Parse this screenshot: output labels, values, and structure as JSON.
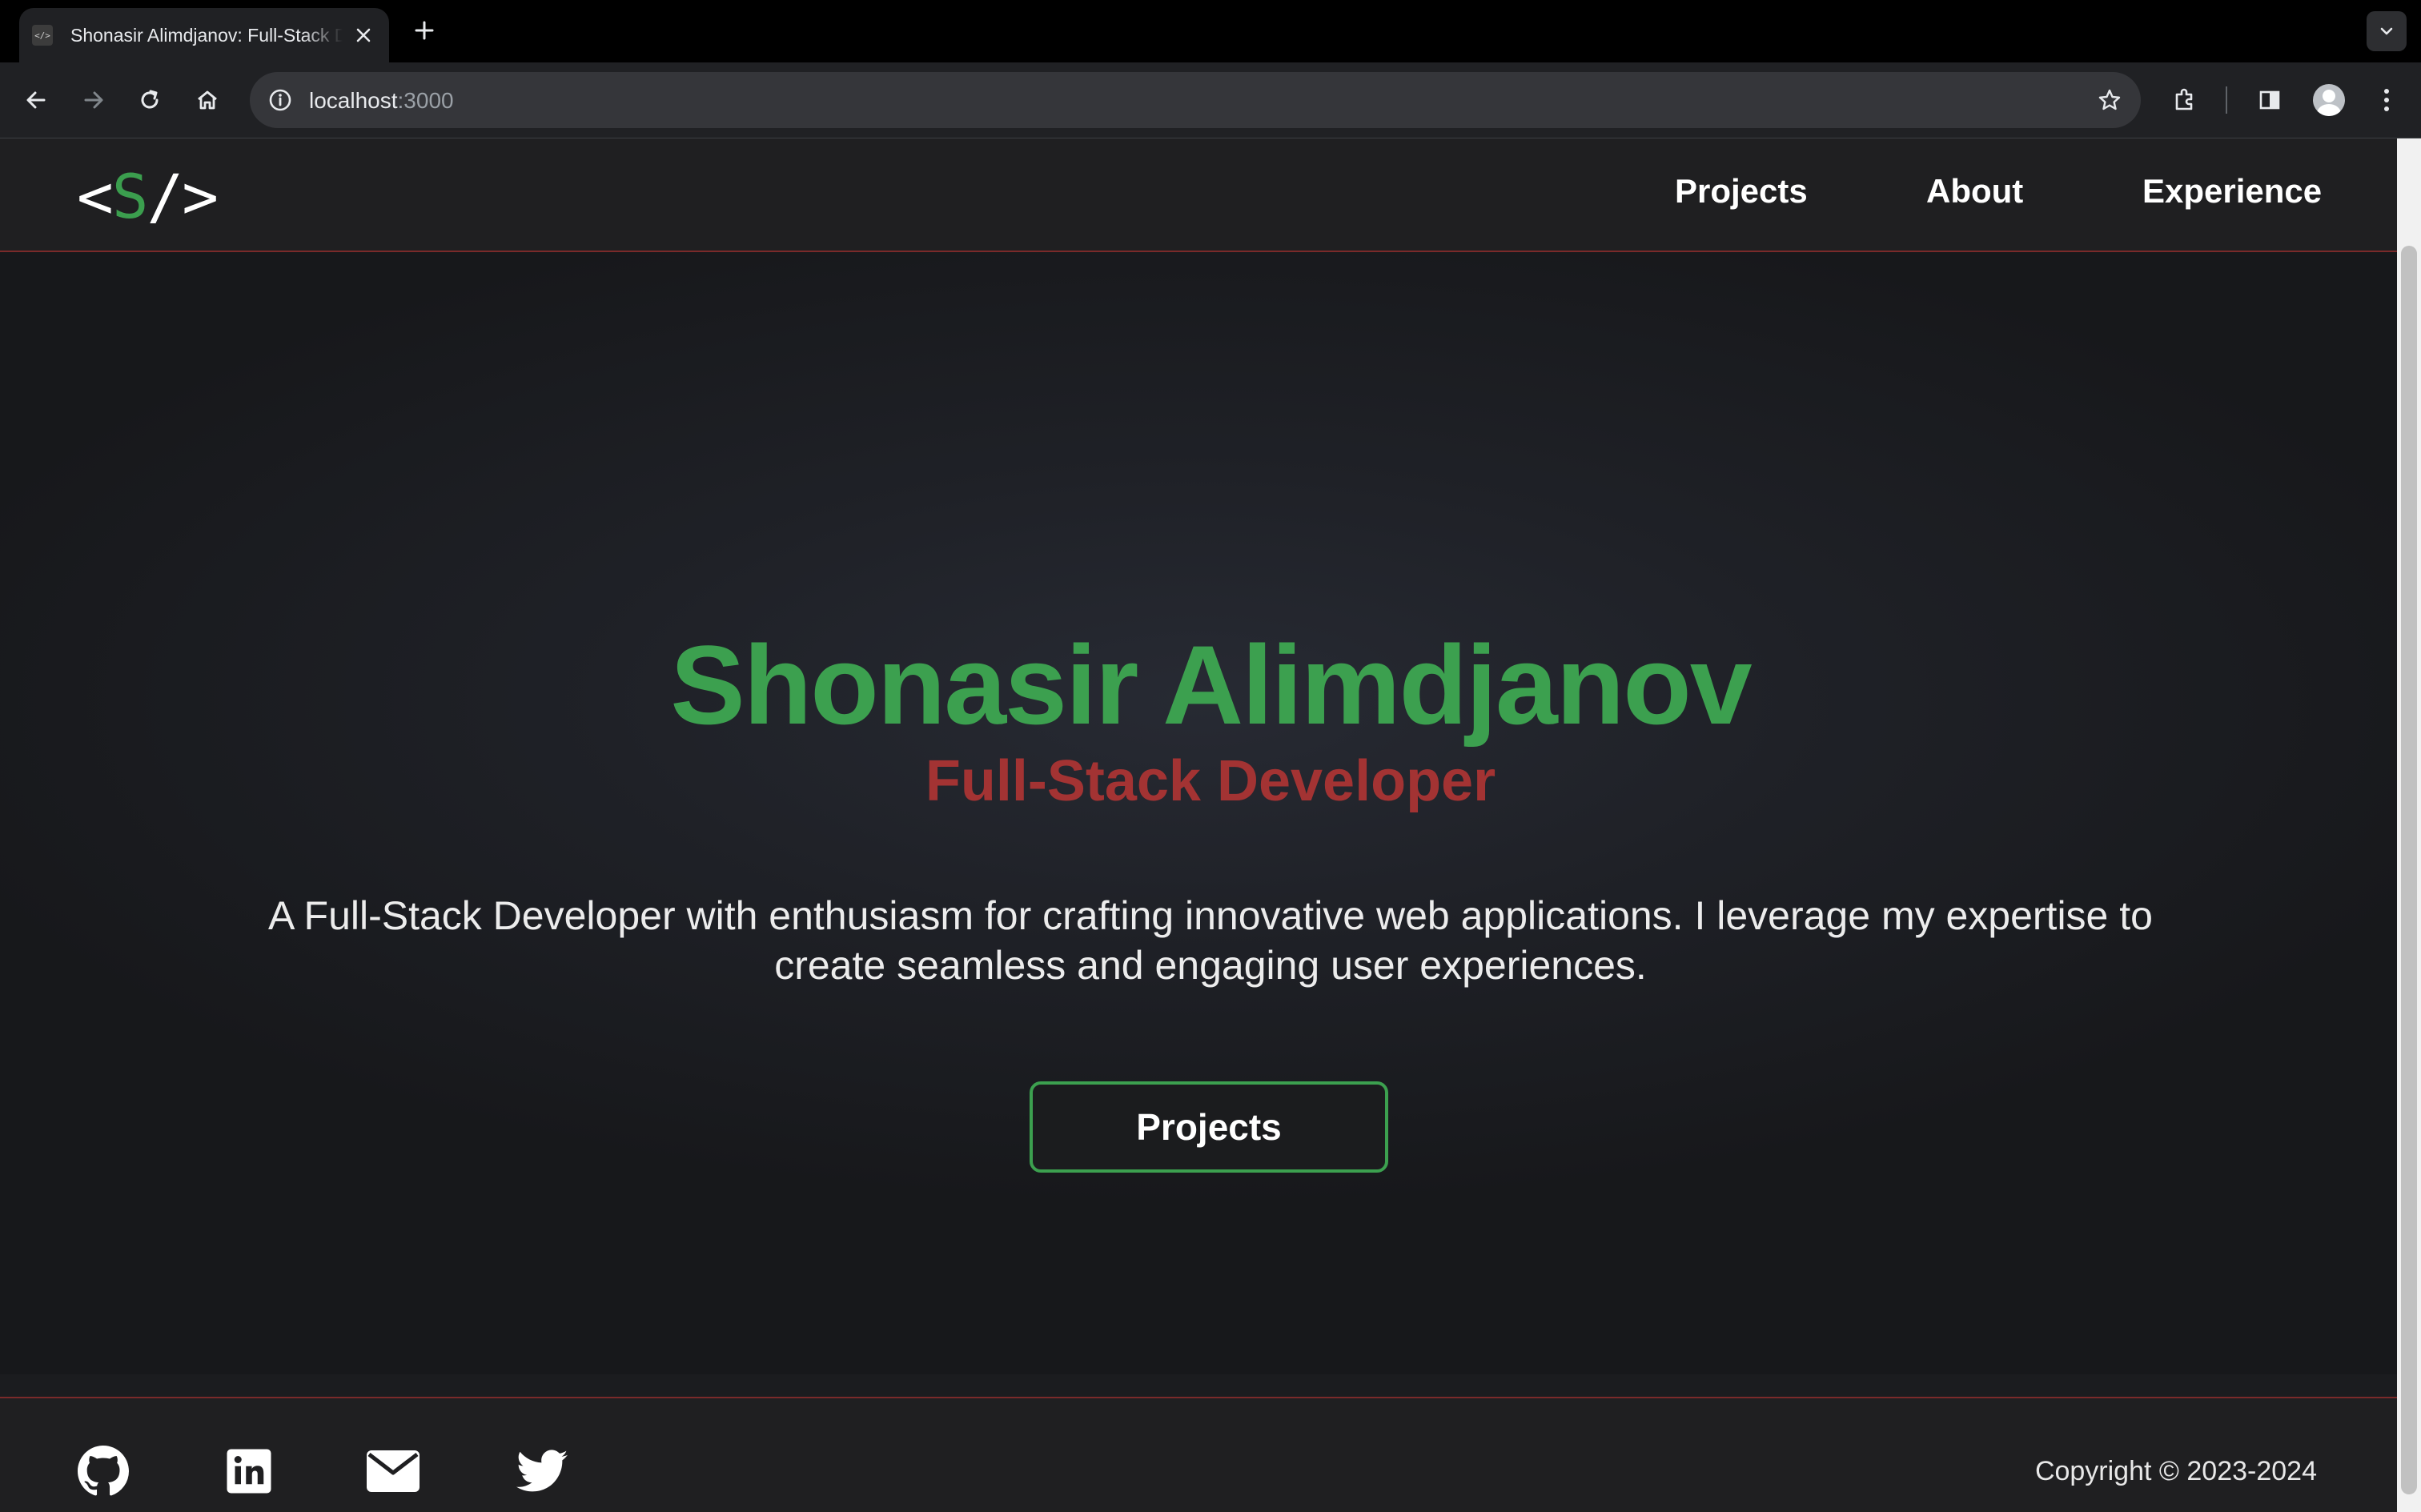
{
  "browser": {
    "tab_title": "Shonasir Alimdjanov: Full-Stack Developer",
    "tab_favicon_text": "</>",
    "url_host": "localhost",
    "url_port": ":3000"
  },
  "header": {
    "logo_left": "<",
    "logo_letter": "S",
    "logo_right": "/>",
    "nav": [
      "Projects",
      "About",
      "Experience"
    ]
  },
  "hero": {
    "name": "Shonasir Alimdjanov",
    "role": "Full-Stack Developer",
    "description": "A Full-Stack Developer with enthusiasm for crafting innovative web applications. I leverage my expertise to create seamless and engaging user experiences.",
    "cta_label": "Projects"
  },
  "footer": {
    "social_icons": [
      "github-icon",
      "linkedin-icon",
      "mail-icon",
      "twitter-icon"
    ],
    "copyright": "Copyright © 2023-2024"
  },
  "colors": {
    "accent_green": "#3ca04f",
    "accent_red": "#a33333",
    "background": "#1b1c1f"
  }
}
